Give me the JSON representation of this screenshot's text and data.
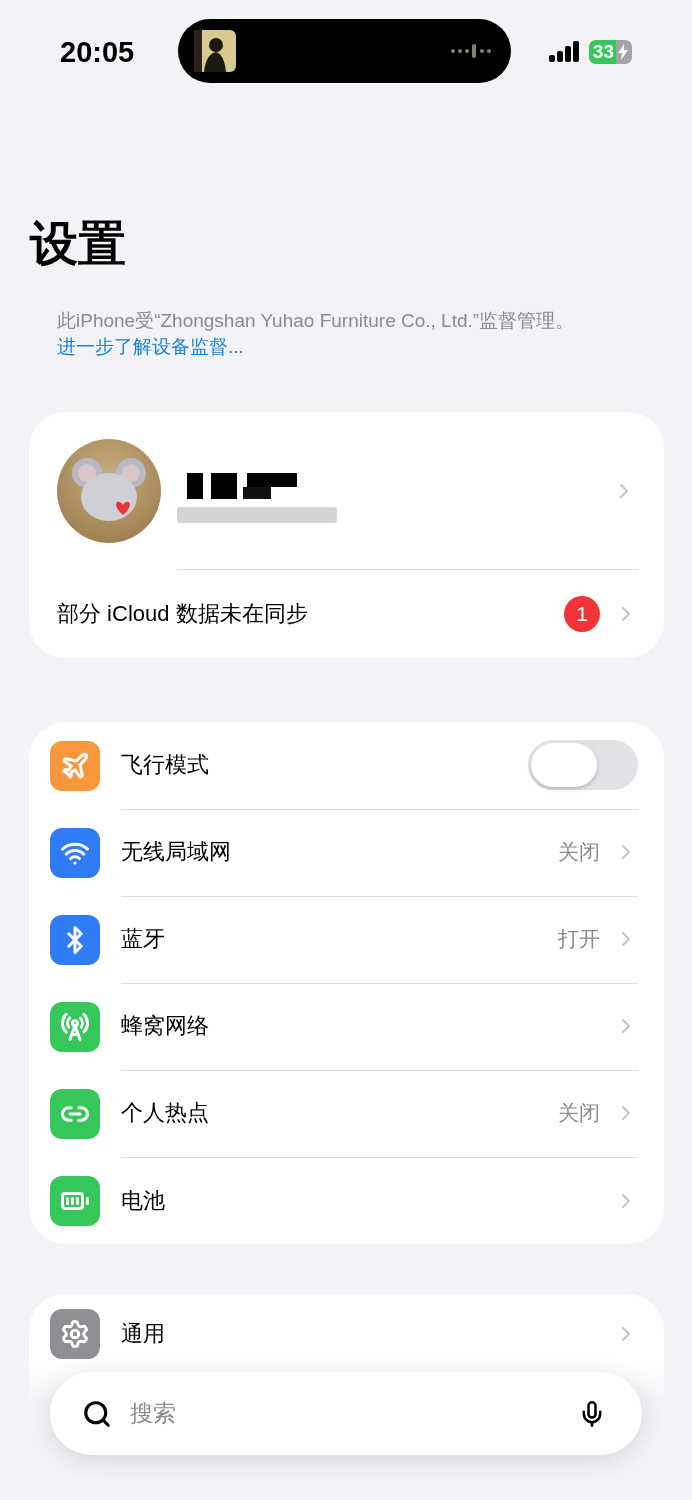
{
  "status_bar": {
    "time": "20:05",
    "battery": "33",
    "charging": true
  },
  "title": "设置",
  "supervision": {
    "text": "此iPhone受“Zhongshan Yuhao Furniture Co., Ltd.”监督管理。",
    "link": "进一步了解设备监督..."
  },
  "account": {
    "sync_notice": "部分 iCloud 数据未在同步",
    "badge": "1"
  },
  "connectivity": [
    {
      "kind": "toggle",
      "label": "飞行模式",
      "on": false,
      "color": "#f7963a"
    },
    {
      "kind": "link",
      "label": "无线局域网",
      "value": "关闭",
      "color": "#2f7cf6"
    },
    {
      "kind": "link",
      "label": "蓝牙",
      "value": "打开",
      "color": "#2f7cf6"
    },
    {
      "kind": "link",
      "label": "蜂窝网络",
      "color": "#35c759"
    },
    {
      "kind": "link",
      "label": "个人热点",
      "value": "关闭",
      "color": "#35c759"
    },
    {
      "kind": "link",
      "label": "电池",
      "color": "#35c759"
    }
  ],
  "general": [
    {
      "kind": "link",
      "label": "通用",
      "color": "#8e8e93"
    }
  ],
  "search": {
    "placeholder": "搜索"
  }
}
